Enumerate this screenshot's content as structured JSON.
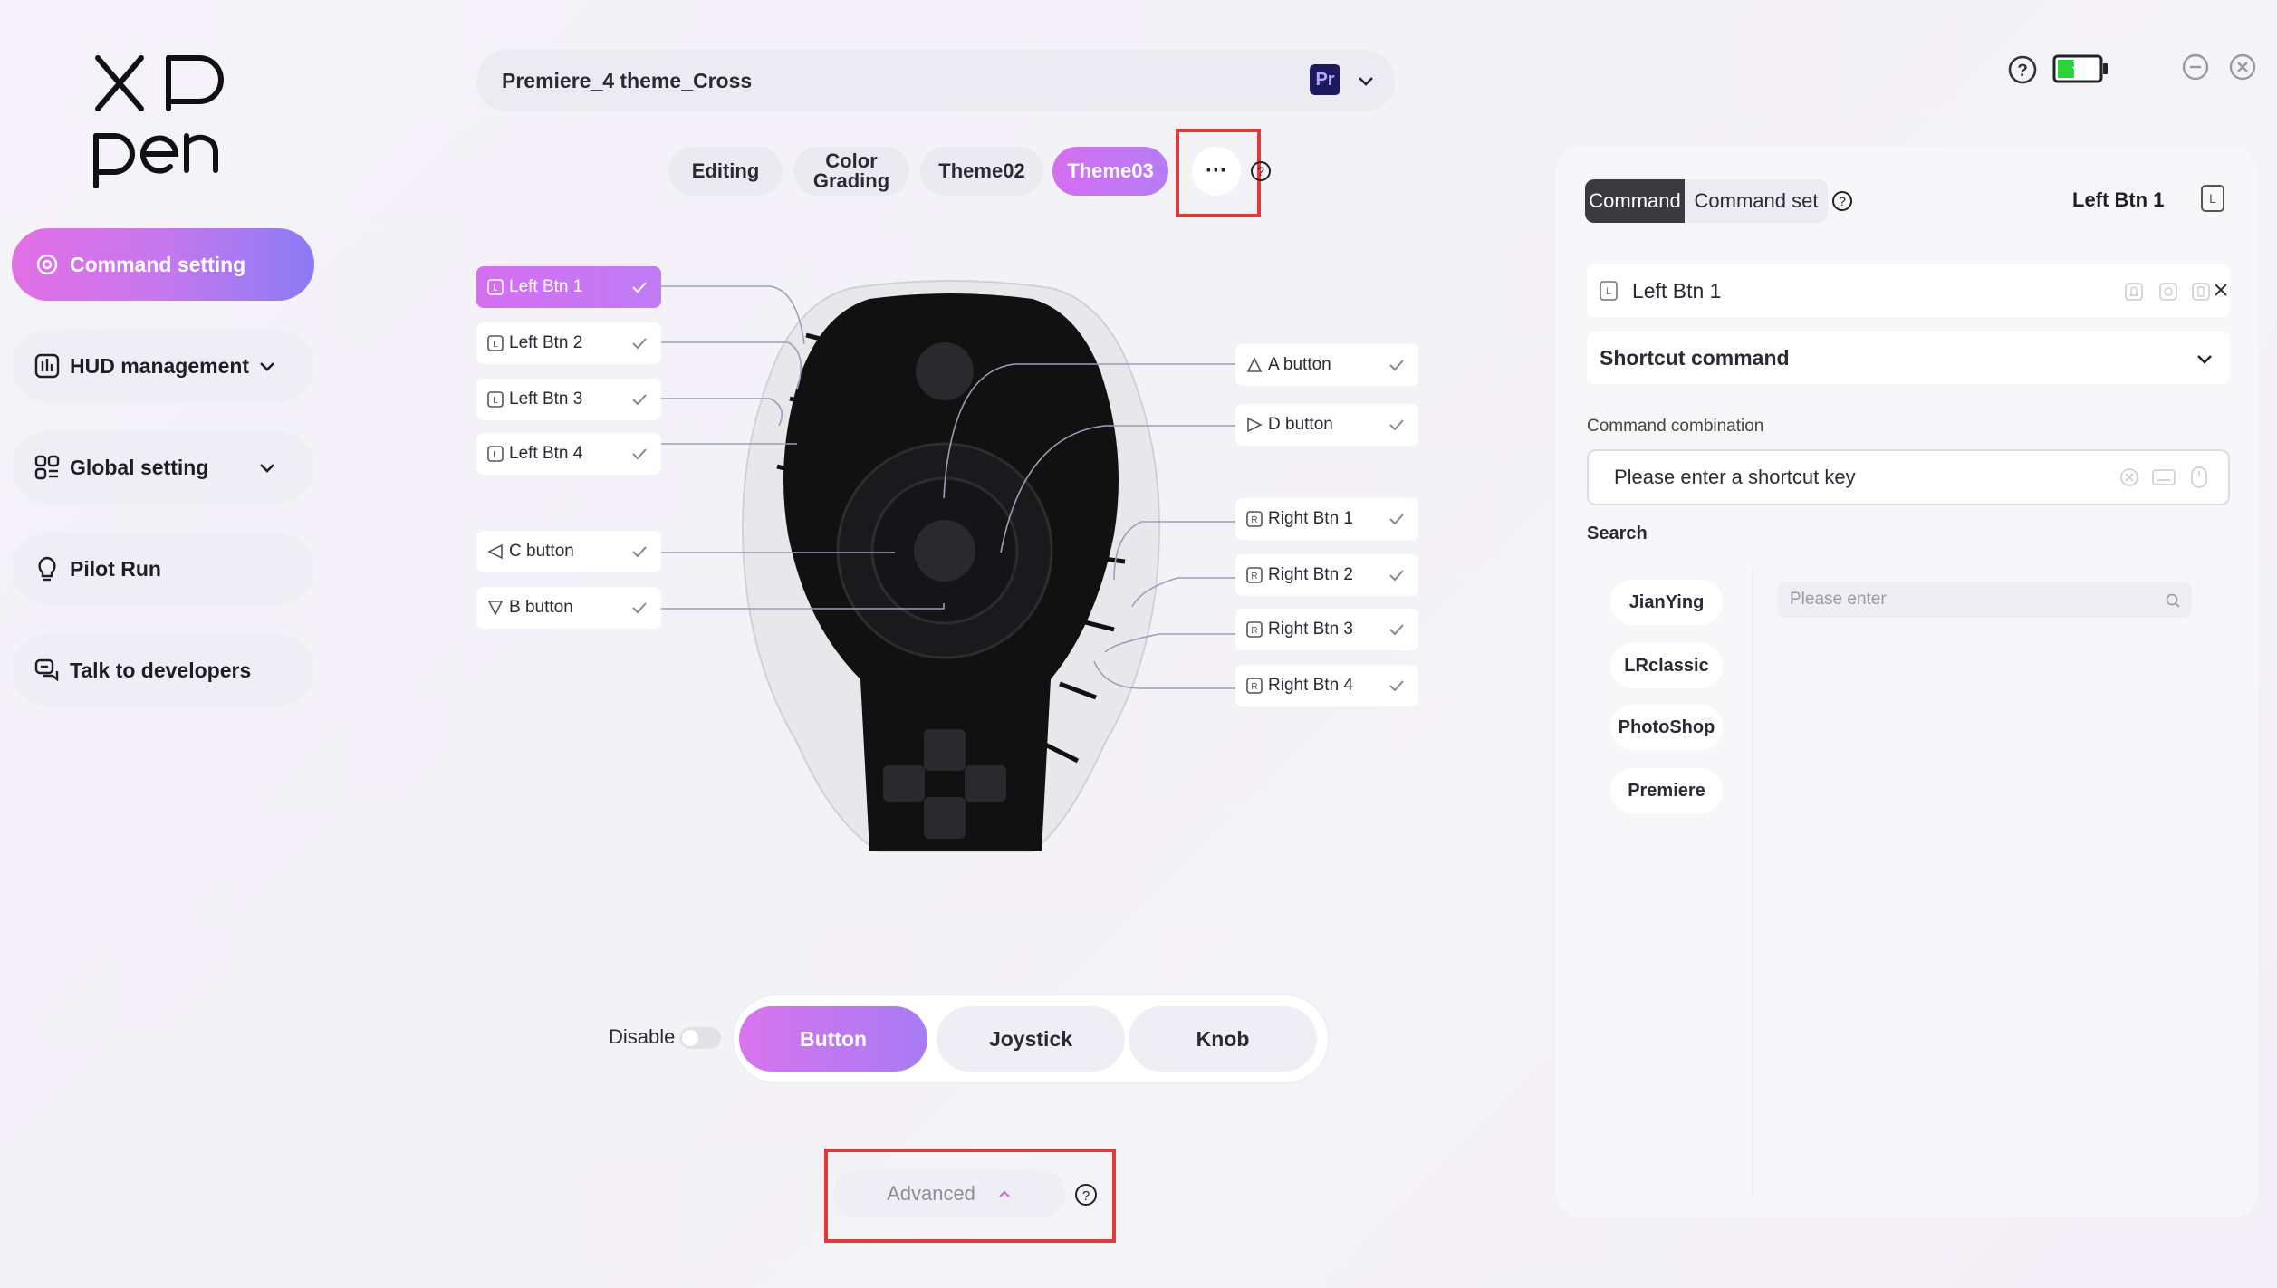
{
  "brand": {
    "logo_text": "XPpen"
  },
  "sidebar": {
    "items": [
      {
        "label": "Command setting",
        "icon": "target-icon",
        "active": true
      },
      {
        "label": "HUD management",
        "icon": "chart-icon",
        "expandable": true
      },
      {
        "label": "Global setting",
        "icon": "grid-icon",
        "expandable": true
      },
      {
        "label": "Pilot Run",
        "icon": "bulb-icon"
      },
      {
        "label": "Talk to developers",
        "icon": "chat-icon"
      }
    ]
  },
  "header": {
    "profile_name": "Premiere_4 theme_Cross",
    "app_badge": "Pr",
    "battery_level": "33"
  },
  "themes": {
    "tabs": [
      "Editing",
      "Color Grading",
      "Theme02",
      "Theme03"
    ],
    "active": "Theme03",
    "more_label": "···"
  },
  "device_buttons": {
    "left": [
      "Left Btn 1",
      "Left Btn 2",
      "Left Btn 3",
      "Left Btn 4"
    ],
    "left_lower": [
      "C button",
      "B button"
    ],
    "right_upper": [
      "A button",
      "D button"
    ],
    "right": [
      "Right Btn 1",
      "Right Btn 2",
      "Right Btn 3",
      "Right Btn 4"
    ],
    "selected": "Left Btn 1"
  },
  "mode": {
    "disable_label": "Disable",
    "options": [
      "Button",
      "Joystick",
      "Knob"
    ],
    "active": "Button"
  },
  "advanced": {
    "label": "Advanced"
  },
  "panel": {
    "seg_command": "Command",
    "seg_command_set": "Command set",
    "current_button": "Left Btn 1",
    "current_button_badge": "L",
    "assigned_label": "Left Btn 1",
    "type_select": "Shortcut command",
    "combination_label": "Command combination",
    "shortcut_placeholder": "Please enter a shortcut key",
    "search_label": "Search",
    "search_placeholder": "Please enter",
    "apps": [
      "JianYing",
      "LRclassic",
      "PhotoShop",
      "Premiere"
    ]
  },
  "colors": {
    "accent_gradient_start": "#e26fe6",
    "accent_gradient_end": "#8a7bf4",
    "highlight_box": "#e03a3a"
  }
}
